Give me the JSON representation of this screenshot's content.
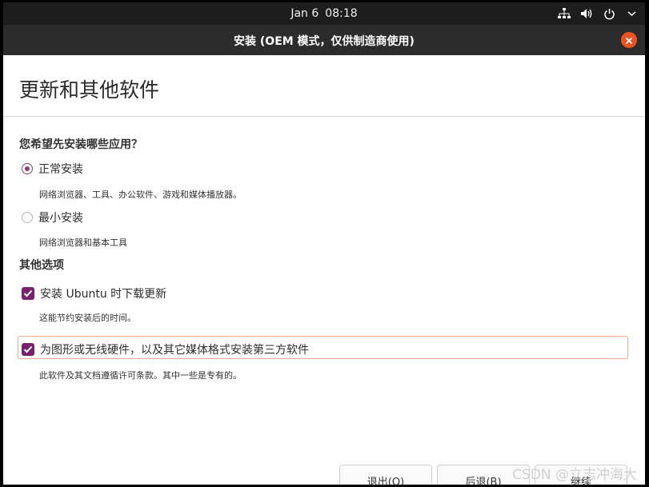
{
  "topbar": {
    "date": "Jan 6",
    "time": "08:18",
    "icons": [
      "network-icon",
      "volume-icon",
      "power-icon",
      "chevron-down-icon"
    ]
  },
  "window": {
    "title": "安装 (OEM 模式，仅供制造商使用)",
    "close_icon": "close-icon",
    "close_color": "#e95420"
  },
  "page": {
    "title": "更新和其他软件"
  },
  "install_type": {
    "heading": "您希望先安装哪些应用？",
    "options": [
      {
        "label": "正常安装",
        "desc": "网络浏览器、工具、办公软件、游戏和媒体播放器。",
        "selected": true
      },
      {
        "label": "最小安装",
        "desc": "网络浏览器和基本工具",
        "selected": false
      }
    ]
  },
  "other_options": {
    "heading": "其他选项",
    "items": [
      {
        "label": "安装 Ubuntu 时下载更新",
        "desc": "这能节约安装后的时间。",
        "checked": true
      },
      {
        "label": "为图形或无线硬件，以及其它媒体格式安装第三方软件",
        "desc": "此软件及其文档遵循许可条款。其中一些是专有的。",
        "checked": true
      }
    ]
  },
  "footer": {
    "quit_label": "退出(Q)",
    "back_label": "后退(B)",
    "continue_label": "继续"
  },
  "watermark": "CSDN @立志冲海大",
  "colors": {
    "accent": "#77216f",
    "radio_accent": "#8f3b74",
    "focus_outline": "#f0a98d",
    "topbar_bg": "#1d1d1d",
    "titlebar_bg": "#2c2c2c"
  }
}
